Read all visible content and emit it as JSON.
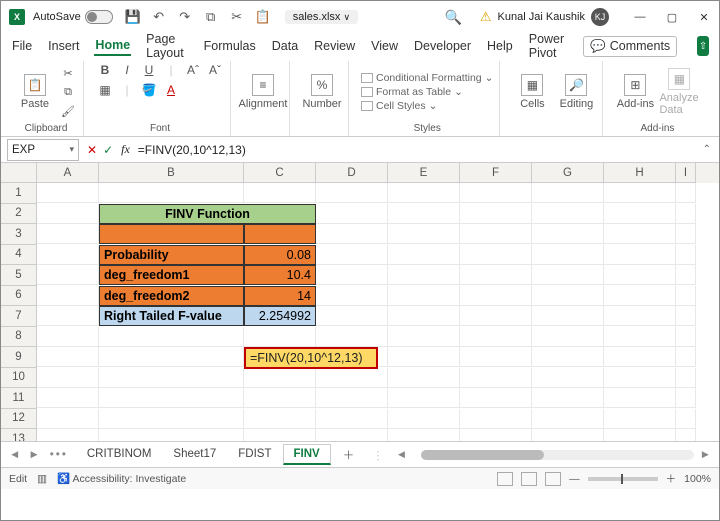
{
  "titlebar": {
    "autosave_label": "AutoSave",
    "autosave_on": false,
    "filename": "sales.xlsx",
    "filename_suffix": "∨",
    "user_name": "Kunal Jai Kaushik",
    "user_initials": "KJ"
  },
  "menu": {
    "items": [
      "File",
      "Insert",
      "Home",
      "Page Layout",
      "Formulas",
      "Data",
      "Review",
      "View",
      "Developer",
      "Help",
      "Power Pivot"
    ],
    "active": "Home",
    "comments": "Comments"
  },
  "ribbon": {
    "clipboard": {
      "label": "Clipboard",
      "paste": "Paste"
    },
    "font": {
      "label": "Font"
    },
    "alignment": {
      "label": "Alignment",
      "btn": "Alignment"
    },
    "number": {
      "label": "Number",
      "btn": "Number"
    },
    "styles": {
      "label": "Styles",
      "cond": "Conditional Formatting",
      "table": "Format as Table",
      "cell": "Cell Styles"
    },
    "cells": {
      "label": "Cells",
      "btn": "Cells"
    },
    "editing": {
      "label": "",
      "btn": "Editing"
    },
    "addins": {
      "label": "Add-ins",
      "btn": "Add-ins"
    },
    "analyze": {
      "btn": "Analyze Data"
    }
  },
  "formula_bar": {
    "namebox": "EXP",
    "formula": "=FINV(20,10^12,13)"
  },
  "columns": [
    "A",
    "B",
    "C",
    "D",
    "E",
    "F",
    "G",
    "H",
    "I"
  ],
  "rows": [
    1,
    2,
    3,
    4,
    5,
    6,
    7,
    8,
    9,
    10,
    11,
    12,
    13
  ],
  "sheet": {
    "title": "FINV Function",
    "b4": "Probability",
    "c4": "0.08",
    "b5": "deg_freedom1",
    "c5": "10.4",
    "b6": "deg_freedom2",
    "c6": "14",
    "b7": "Right Tailed F-value",
    "c7": "2.254992",
    "c9": "=FINV(20,10^12,13)"
  },
  "colors": {
    "title_bg": "#a8d08d",
    "label_bg": "#ed7d31",
    "result_bg": "#bdd7ee",
    "edit_bg": "#ffd966",
    "edit_border": "#c00000"
  },
  "tabs": {
    "items": [
      "CRITBINOM",
      "Sheet17",
      "FDIST",
      "FINV"
    ],
    "active": "FINV"
  },
  "status": {
    "mode": "Edit",
    "accessibility": "Accessibility: Investigate",
    "zoom": "100%"
  }
}
